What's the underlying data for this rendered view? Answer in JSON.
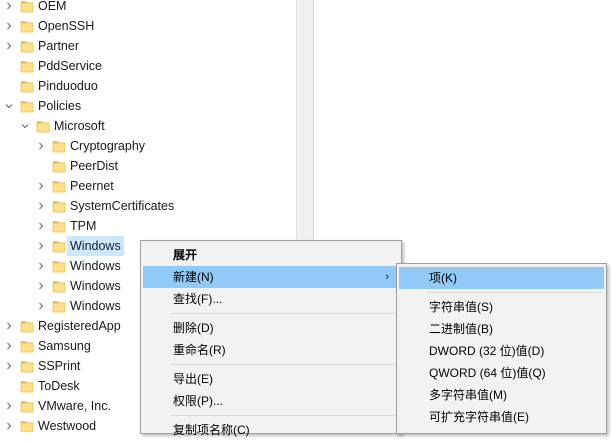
{
  "tree": {
    "items": [
      {
        "label": "OEM",
        "expanded": false
      },
      {
        "label": "OpenSSH",
        "expanded": false
      },
      {
        "label": "Partner",
        "expanded": false
      },
      {
        "label": "PddService",
        "expanded": false
      },
      {
        "label": "Pinduoduo",
        "expanded": false
      },
      {
        "label": "Policies",
        "expanded": true
      },
      {
        "label": "Microsoft",
        "expanded": true
      },
      {
        "label": "Cryptography",
        "expanded": false
      },
      {
        "label": "PeerDist",
        "expanded": false
      },
      {
        "label": "Peernet",
        "expanded": false
      },
      {
        "label": "SystemCertificates",
        "expanded": false
      },
      {
        "label": "TPM",
        "expanded": false
      },
      {
        "label": "Windows",
        "expanded": false,
        "selected": true
      },
      {
        "label": "Windows",
        "expanded": false
      },
      {
        "label": "Windows",
        "expanded": false
      },
      {
        "label": "Windows",
        "expanded": false
      },
      {
        "label": "RegisteredApp",
        "expanded": false
      },
      {
        "label": "Samsung",
        "expanded": false
      },
      {
        "label": "SSPrint",
        "expanded": false
      },
      {
        "label": "ToDesk",
        "expanded": false
      },
      {
        "label": "VMware, Inc.",
        "expanded": false
      },
      {
        "label": "Westwood",
        "expanded": false
      }
    ]
  },
  "context_menu": {
    "items": [
      {
        "label": "展开",
        "bold": true
      },
      {
        "label": "新建(N)",
        "has_submenu": true,
        "highlight": true
      },
      {
        "label": "查找(F)..."
      },
      {
        "separator": true
      },
      {
        "label": "删除(D)"
      },
      {
        "label": "重命名(R)"
      },
      {
        "separator": true
      },
      {
        "label": "导出(E)"
      },
      {
        "label": "权限(P)..."
      },
      {
        "separator": true
      },
      {
        "label": "复制项名称(C)"
      }
    ],
    "submenu_arrow": "›"
  },
  "submenu": {
    "items": [
      {
        "label": "项(K)",
        "highlight": true
      },
      {
        "separator": true
      },
      {
        "label": "字符串值(S)"
      },
      {
        "label": "二进制值(B)"
      },
      {
        "label": "DWORD (32 位)值(D)"
      },
      {
        "label": "QWORD (64 位)值(Q)"
      },
      {
        "label": "多字符串值(M)"
      },
      {
        "label": "可扩充字符串值(E)"
      }
    ]
  },
  "colors": {
    "folder_fill": "#ffe08a",
    "folder_tab": "#f4c542",
    "selection": "#cce8ff",
    "menu_highlight": "#91c9f7"
  }
}
